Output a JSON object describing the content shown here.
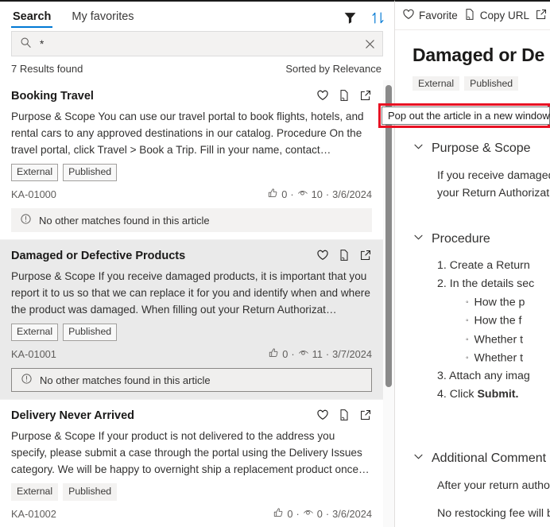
{
  "left": {
    "tabs": [
      {
        "label": "Search",
        "active": true
      },
      {
        "label": "My favorites",
        "active": false
      }
    ],
    "toolbar": {
      "filter_icon": "filter-funnel-icon",
      "sort_icon": "sort-arrows-icon"
    },
    "search": {
      "icon": "search-icon",
      "value": "*",
      "placeholder": "",
      "clear_icon": "close-icon"
    },
    "results_count": "7 Results found",
    "sort_label": "Sorted by Relevance",
    "cards": [
      {
        "title": "Booking Travel",
        "snippet": "Purpose & Scope You can use our travel portal to book flights, hotels, and rental cars to any approved destinations in our catalog. Procedure On the travel portal, click Travel > Book a Trip. Fill in your name, contact informati…",
        "chips": [
          "External",
          "Published"
        ],
        "chip_style": "bordered",
        "article_id": "KA-01000",
        "likes": "0",
        "views": "10",
        "date": "3/6/2024",
        "banner": "No other matches found in this article",
        "banner_bordered": false,
        "selected": false
      },
      {
        "title": "Damaged or Defective Products",
        "snippet": "   Purpose & Scope If you receive damaged products, it is important that you report it to us so that we can replace it for you and identify when and where the product was damaged. When filling out your Return Authorizat…",
        "chips": [
          "External",
          "Published"
        ],
        "chip_style": "bordered",
        "article_id": "KA-01001",
        "likes": "0",
        "views": "11",
        "date": "3/7/2024",
        "banner": "No other matches found in this article",
        "banner_bordered": true,
        "selected": true
      },
      {
        "title": "Delivery Never Arrived",
        "snippet": "Purpose & Scope If your product is not delivered to the address you specify, please submit a case through the portal using the Delivery Issues category. We will be happy to overnight ship a replacement product once we…",
        "chips": [
          "External",
          "Published"
        ],
        "chip_style": "plain",
        "article_id": "KA-01002",
        "likes": "0",
        "views": "0",
        "date": "3/6/2024",
        "banner": "",
        "banner_bordered": false,
        "selected": false
      }
    ],
    "separator": "·"
  },
  "right": {
    "toolbar": [
      {
        "label": "Favorite",
        "icon": "heart-icon"
      },
      {
        "label": "Copy URL",
        "icon": "copy-url-icon"
      },
      {
        "label": "",
        "icon": "pop-out-icon"
      }
    ],
    "title": "Damaged or De",
    "chips": [
      "External",
      "Published"
    ],
    "sections": [
      {
        "heading": "Purpose & Scope",
        "paragraphs": [
          "If you receive damaged",
          "your Return Authorizat"
        ]
      },
      {
        "heading": "Procedure",
        "list": [
          "1. Create a Return ",
          "2. In the details sec"
        ],
        "sublist": [
          "How the p",
          "How the f",
          "Whether t",
          "Whether t"
        ],
        "list_tail": [
          "3. Attach any imag",
          "4. Click "
        ],
        "tail_bold": "Submit."
      },
      {
        "heading": "Additional Comment",
        "paragraphs": [
          "After your return autho",
          "No restocking fee will b"
        ]
      }
    ]
  },
  "tooltip": {
    "text": "Pop out the article in a new window",
    "highlight_color": "#e81123"
  },
  "scrollbar": {
    "thumb_color": "#8a8a8a"
  }
}
